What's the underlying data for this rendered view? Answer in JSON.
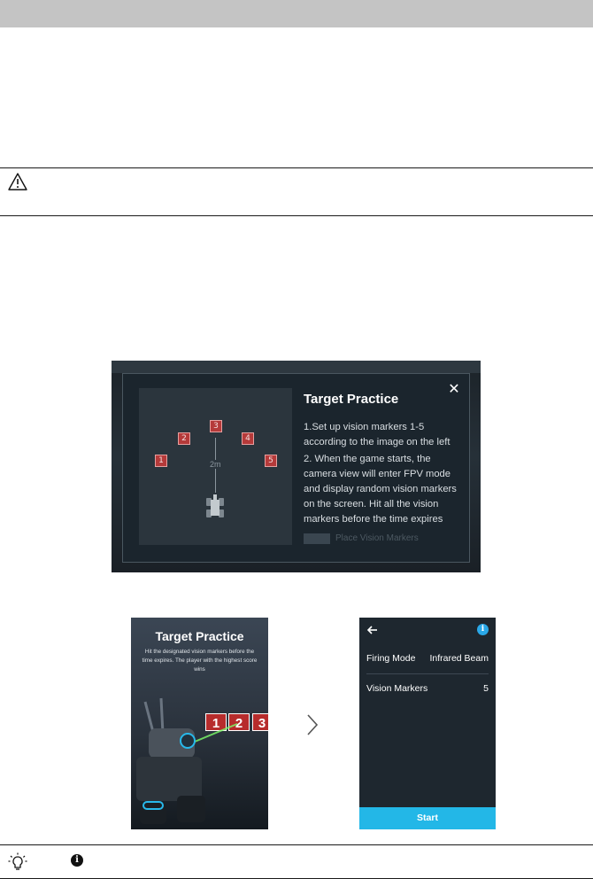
{
  "dialog": {
    "title": "Target Practice",
    "close_symbol": "✕",
    "step1": "1.Set up vision markers 1-5 according to the image on the left",
    "step2": "2. When the game starts, the camera view will enter FPV mode and display random vision markers on the screen. Hit all the vision markers before the time expires",
    "place_label": "Place Vision Markers",
    "diagram": {
      "markers": [
        "1",
        "2",
        "3",
        "4",
        "5"
      ],
      "distance": "2m"
    }
  },
  "splash": {
    "title": "Target Practice",
    "description": "Hit the designated vision markers before the time expires. The player with the highest score wins",
    "visible_markers": [
      "1",
      "2",
      "3"
    ]
  },
  "settings": {
    "firing_mode_label": "Firing Mode",
    "firing_mode_value": "Infrared Beam",
    "vision_markers_label": "Vision Markers",
    "vision_markers_value": "5",
    "start_label": "Start",
    "info_symbol": "i"
  },
  "footer": {
    "note_symbol": "i"
  },
  "colors": {
    "accent": "#23b7e7",
    "marker_red": "#b53a3a",
    "dialog_bg": "#1b252d"
  },
  "icons": [
    "warning-icon",
    "close-icon",
    "back-arrow-icon",
    "info-icon",
    "chevron-right-icon",
    "lightbulb-icon",
    "note-info-icon",
    "robot-icon"
  ]
}
